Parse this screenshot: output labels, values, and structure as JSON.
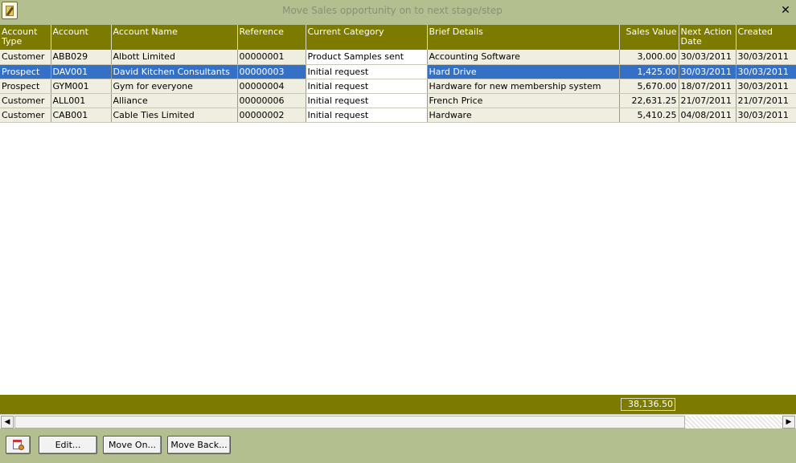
{
  "window": {
    "title": "Move Sales opportunity on to next stage/step",
    "close_glyph": "✕",
    "icon": "notepad-pen-icon"
  },
  "grid": {
    "columns": [
      {
        "label": "Account Type"
      },
      {
        "label": "Account"
      },
      {
        "label": "Account Name"
      },
      {
        "label": "Reference"
      },
      {
        "label": "Current Category"
      },
      {
        "label": "Brief Details"
      },
      {
        "label": "Sales Value"
      },
      {
        "label": "Next Action Date"
      },
      {
        "label": "Created"
      }
    ],
    "rows": [
      {
        "type": "Customer",
        "account": "ABB029",
        "name": "Albott Limited",
        "reference": "00000001",
        "category": "Product Samples sent",
        "details": "Accounting Software",
        "value": "3,000.00",
        "next_action": "30/03/2011",
        "created": "30/03/2011"
      },
      {
        "type": "Prospect",
        "account": "DAV001",
        "name": "David Kitchen Consultants",
        "reference": "00000003",
        "category": "Initial request",
        "details": "Hard Drive",
        "value": "1,425.00",
        "next_action": "30/03/2011",
        "created": "30/03/2011"
      },
      {
        "type": "Prospect",
        "account": "GYM001",
        "name": "Gym for everyone",
        "reference": "00000004",
        "category": "Initial request",
        "details": "Hardware for new membership system",
        "value": "5,670.00",
        "next_action": "18/07/2011",
        "created": "30/03/2011"
      },
      {
        "type": "Customer",
        "account": "ALL001",
        "name": "Alliance",
        "reference": "00000006",
        "category": "Initial request",
        "details": "French Price",
        "value": "22,631.25",
        "next_action": "21/07/2011",
        "created": "21/07/2011"
      },
      {
        "type": "Customer",
        "account": "CAB001",
        "name": "Cable Ties Limited",
        "reference": "00000002",
        "category": "Initial request",
        "details": "Hardware",
        "value": "5,410.25",
        "next_action": "04/08/2011",
        "created": "30/03/2011"
      }
    ],
    "selected_row": "DAV001",
    "total_sales_value": "38,136.50"
  },
  "scrollbar": {
    "left_arrow": "◀",
    "right_arrow": "▶"
  },
  "footer": {
    "icon_button": "calendar-icon",
    "edit_label": "Edit...",
    "move_on_label": "Move On...",
    "move_back_label": "Move Back..."
  },
  "colors": {
    "header_bg": "#7c7b00",
    "window_bg": "#b4bf8f",
    "selected_row_bg": "#3470c6",
    "row_bg": "#f0eee0"
  }
}
